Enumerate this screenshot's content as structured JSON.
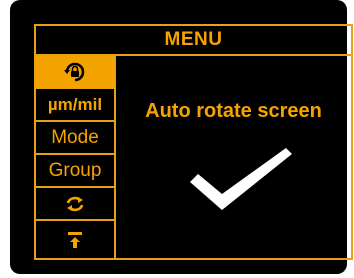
{
  "menu": {
    "title": "MENU"
  },
  "sidebar": {
    "items": [
      {
        "id": "rotate-lock",
        "icon": "rotate-lock-icon",
        "selected": true
      },
      {
        "id": "unit",
        "label": "µm/mil",
        "selected": false
      },
      {
        "id": "mode",
        "label": "Mode",
        "selected": false
      },
      {
        "id": "group",
        "label": "Group",
        "selected": false
      },
      {
        "id": "sync",
        "icon": "refresh-icon",
        "selected": false
      },
      {
        "id": "upload",
        "icon": "upload-icon",
        "selected": false
      }
    ]
  },
  "content": {
    "description": "Auto rotate screen",
    "status_icon": "checkmark-icon",
    "enabled": true
  },
  "colors": {
    "accent": "#f5a300",
    "background": "#000000",
    "checkmark": "#ffffff"
  }
}
